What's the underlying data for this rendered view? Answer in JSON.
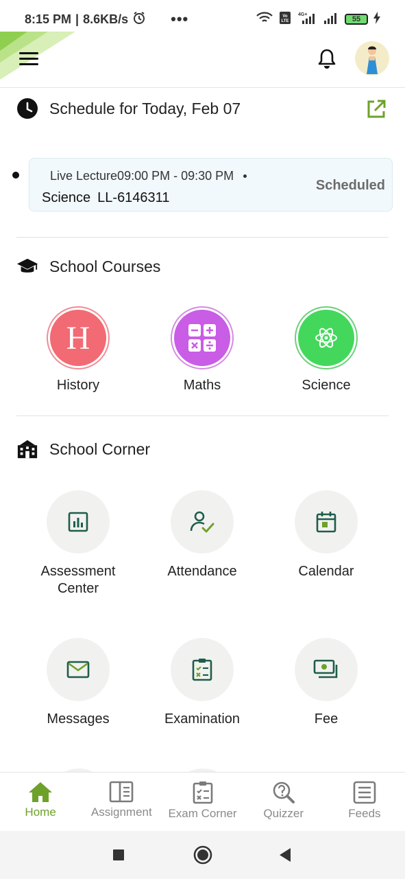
{
  "status_bar": {
    "time": "8:15 PM",
    "speed": "8.6KB/s",
    "more": "•••",
    "battery": "55"
  },
  "header": {
    "menu_icon": "hamburger-icon",
    "bell_icon": "bell-icon",
    "avatar_icon": "avatar"
  },
  "schedule": {
    "title": "Schedule for Today, Feb 07",
    "lecture": {
      "type_time": "Live Lecture09:00 PM - 09:30 PM",
      "subject": "Science",
      "code": "LL-6146311",
      "status": "Scheduled"
    }
  },
  "courses": {
    "title": "School Courses",
    "items": [
      {
        "label": "History",
        "letter": "H",
        "color": "#f26a74",
        "ring": "#f08c95"
      },
      {
        "label": "Maths",
        "color": "#c95de6",
        "ring": "#d48be4"
      },
      {
        "label": "Science",
        "color": "#43d85c",
        "ring": "#6bcf79"
      }
    ]
  },
  "corner": {
    "title": "School Corner",
    "tiles": [
      {
        "label": "Assessment Center",
        "icon": "chart-icon"
      },
      {
        "label": "Attendance",
        "icon": "user-check-icon"
      },
      {
        "label": "Calendar",
        "icon": "calendar-icon"
      },
      {
        "label": "Messages",
        "icon": "envelope-icon"
      },
      {
        "label": "Examination",
        "icon": "clipboard-icon"
      },
      {
        "label": "Fee",
        "icon": "money-icon"
      }
    ]
  },
  "bottom_nav": {
    "items": [
      {
        "label": "Home",
        "icon": "home-icon",
        "active": true
      },
      {
        "label": "Assignment",
        "icon": "book-icon"
      },
      {
        "label": "Exam Corner",
        "icon": "clipboard-list-icon"
      },
      {
        "label": "Quizzer",
        "icon": "quiz-icon"
      },
      {
        "label": "Feeds",
        "icon": "feeds-icon"
      }
    ]
  },
  "colors": {
    "brand_green": "#6ea12a",
    "tile_icon": "#1e5d4b",
    "accent_green": "#5fb030"
  }
}
